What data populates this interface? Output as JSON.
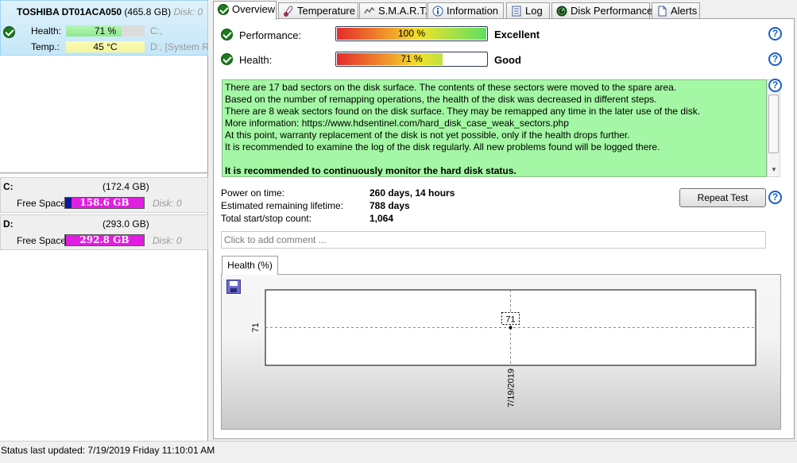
{
  "disk": {
    "model": "TOSHIBA DT01ACA050",
    "size": "(465.8 GB)",
    "disk_label": "Disk: 0",
    "health_label": "Health:",
    "health_value": "71 %",
    "temp_label": "Temp.:",
    "temp_value": "45 °C",
    "drives_line1": "C:,",
    "drives_line2": "D:, [System R",
    "health_fraction": 0.71
  },
  "volumes": [
    {
      "letter": "C:",
      "size": "(172.4 GB)",
      "free_label": "Free Space",
      "free_value": "158.6 GB",
      "disk": "Disk: 0",
      "used_fraction": 0.08
    },
    {
      "letter": "D:",
      "size": "(293.0 GB)",
      "free_label": "Free Space",
      "free_value": "292.8 GB",
      "disk": "Disk: 0",
      "used_fraction": 0.01
    }
  ],
  "tabs": [
    {
      "label": "Overview",
      "icon": "check-icon",
      "active": true
    },
    {
      "label": "Temperature",
      "icon": "thermometer-icon"
    },
    {
      "label": "S.M.A.R.T.",
      "icon": "smart-icon"
    },
    {
      "label": "Information",
      "icon": "info-icon"
    },
    {
      "label": "Log",
      "icon": "log-icon"
    },
    {
      "label": "Disk Performance",
      "icon": "gauge-icon"
    },
    {
      "label": "Alerts",
      "icon": "alerts-icon"
    }
  ],
  "overview": {
    "performance_label": "Performance:",
    "performance_value": "100 %",
    "performance_word": "Excellent",
    "performance_fraction": 1.0,
    "health_label": "Health:",
    "health_value": "71 %",
    "health_word": "Good",
    "health_fraction": 0.71,
    "messages": [
      "There are 17 bad sectors on the disk surface. The contents of these sectors were moved to the spare area.",
      "Based on the number of remapping operations, the health of the disk was decreased in different steps.",
      "There are 8 weak sectors found on the disk surface. They may be remapped any time in the later use of the disk.",
      "More information: https://www.hdsentinel.com/hard_disk_case_weak_sectors.php",
      "At this point, warranty replacement of the disk is not yet possible, only if the health drops further.",
      "It is recommended to examine the log of the disk regularly. All new problems found will be logged there."
    ],
    "recommendation": "It is recommended to continuously monitor the hard disk status.",
    "power_on_label": "Power on time:",
    "power_on_value": "260 days, 14 hours",
    "lifetime_label": "Estimated remaining lifetime:",
    "lifetime_value": "788 days",
    "startstop_label": "Total start/stop count:",
    "startstop_value": "1,064",
    "repeat_test_label": "Repeat Test",
    "comment_placeholder": "Click to add comment ...",
    "help_symbol": "?"
  },
  "graph": {
    "tab_label": "Health (%)",
    "chart_data": {
      "type": "line",
      "x": [
        "7/19/2019"
      ],
      "series": [
        {
          "values": [
            71
          ]
        }
      ],
      "y_tick_labels": [
        "71"
      ],
      "data_labels": [
        "71"
      ],
      "grid": true
    }
  },
  "status": {
    "text": "Status last updated: 7/19/2019 Friday 11:10:01 AM"
  },
  "colors": {
    "ok_green": "#1d7a1d",
    "message_bg": "#a4f7a4",
    "help_blue": "#1c5fc8",
    "free_space_magenta": "#e01ee0",
    "used_space_navy": "#1414a0"
  }
}
